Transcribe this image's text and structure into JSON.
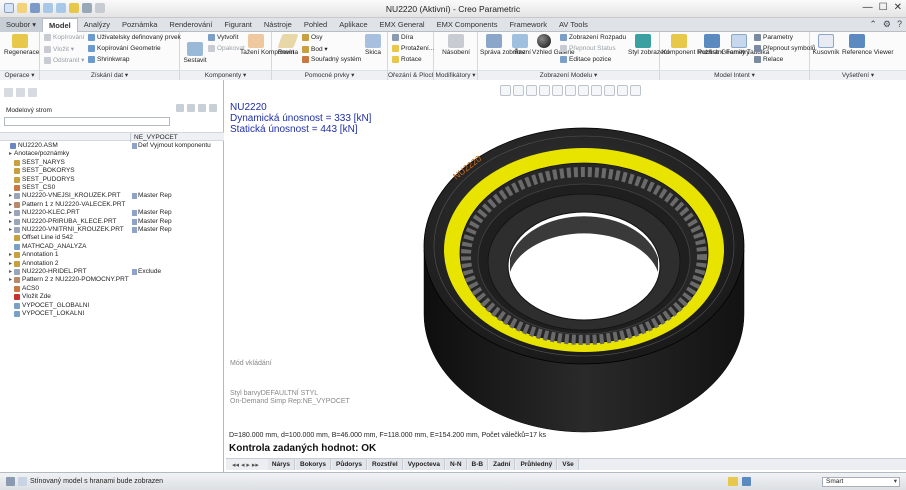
{
  "window": {
    "title": "NU2220 (Aktivní) - Creo Parametric"
  },
  "menu_tabs": [
    "Soubor ▾",
    "Model",
    "Analýzy",
    "Poznámka",
    "Renderování",
    "Figurant",
    "Nástroje",
    "Pohled",
    "Aplikace",
    "EMX General",
    "EMX Components",
    "Framework",
    "AV Tools"
  ],
  "ribbon": {
    "groups": {
      "operace": "Operace ▾",
      "ziskani_dat": "Získání dat ▾",
      "komponenty": "Komponenty ▾",
      "pomocne_prvky": "Pomocné prvky ▾",
      "orezani": "Ořezání & Plochy ▾",
      "modifikatory": "Modifikátory ▾",
      "zobrazeni_modelu": "Zobrazení Modelu ▾",
      "model_intent": "Model Intent ▾",
      "vysetreni": "Vyšetření ▾"
    },
    "regenerace": "Regenerace",
    "kopirovani": "Kopírování",
    "vlozit": "Vložit ▾",
    "odstranit": "Odstranit ▾",
    "uzivatelsky": "Uživatelsky definovaný prvek",
    "kopirovani_geometrie": "Kopírování Geometrie",
    "shrinkwrap": "Shrinkwrap",
    "sestavit": "Sestavit",
    "vytvorit": "Vytvořit",
    "opakovat": "Opakovat",
    "tazeni_komponent": "Tažení Komponent",
    "rovina": "Rovina",
    "osy": "Osy",
    "bod": "Bod ▾",
    "souradny_system": "Souřadný systém",
    "skica": "Skica",
    "dira": "Díra",
    "protazeni": "Protažení...",
    "rotace": "Rotace",
    "nasobeni": "Násobení",
    "sprava_zobrazeni": "Správa zobrazení",
    "rez": "Řez",
    "vzhled_galerie": "Vzhled Galerie",
    "zobrazeni_rozpadu": "Zobrazení Rozpadu",
    "prepnout_status": "Přepnout Status",
    "editace_pozice": "Editace pozice",
    "styl_zobrazeni": "Styl zobrazení",
    "komponent_rozhrani": "Komponent Rozhraní",
    "publish_geometry": "Publish Geometry",
    "family_tabulka": "Family Tabulka",
    "parametry": "Parametry",
    "prepnout_symbolu": "Přepnout symbolů",
    "relace": "Relace",
    "kusovnik": "Kusovník",
    "reference_viewer": "Reference Viewer"
  },
  "model_tree": {
    "title": "Modelový strom",
    "column2": "NE_VYPOCET",
    "rows": [
      {
        "name": "NU2220.ASM",
        "col2": "Def  Vyjmout komponentu",
        "color": "#6a87c4",
        "exp": ""
      },
      {
        "name": "Anotace/poznámky",
        "col2": "",
        "color": "",
        "exp": "▸"
      },
      {
        "name": "SEST_NARYS",
        "col2": "",
        "color": "#c8a040",
        "exp": ""
      },
      {
        "name": "SEST_BOKORYS",
        "col2": "",
        "color": "#c8a040",
        "exp": ""
      },
      {
        "name": "SEST_PUDORYS",
        "col2": "",
        "color": "#c8a040",
        "exp": ""
      },
      {
        "name": "SEST_CS0",
        "col2": "",
        "color": "#c87840",
        "exp": ""
      },
      {
        "name": "NU2220-VNEJSI_KROUZEK.PRT",
        "col2": "Master Rep",
        "color": "#9aa6b8",
        "exp": "▸"
      },
      {
        "name": "Pattern 1 z NU2220-VALECEK.PRT",
        "col2": "",
        "color": "#b88a6a",
        "exp": "▸"
      },
      {
        "name": "NU2220-KLEC.PRT",
        "col2": "Master Rep",
        "color": "#9aa6b8",
        "exp": "▸"
      },
      {
        "name": "NU2220-PRIRUBA_KLECE.PRT",
        "col2": "Master Rep",
        "color": "#9aa6b8",
        "exp": "▸"
      },
      {
        "name": "NU2220-VNITRNI_KROUZEK.PRT",
        "col2": "Master Rep",
        "color": "#9aa6b8",
        "exp": "▸"
      },
      {
        "name": "Offset Line id 542",
        "col2": "",
        "color": "#c8a040",
        "exp": ""
      },
      {
        "name": "MATHCAD_ANALYZA",
        "col2": "",
        "color": "#7aa0c8",
        "exp": ""
      },
      {
        "name": "Annotation 1",
        "col2": "",
        "color": "#c8a040",
        "exp": "▸"
      },
      {
        "name": "Annotation 2",
        "col2": "",
        "color": "#c8a040",
        "exp": "▸"
      },
      {
        "name": "NU2220-HRIDEL.PRT",
        "col2": "Exclude",
        "color": "#9aa6b8",
        "exp": "▸"
      },
      {
        "name": "Pattern 2 z NU2220-POMOCNY.PRT",
        "col2": "",
        "color": "#b88a6a",
        "exp": "▸"
      },
      {
        "name": "ACS0",
        "col2": "",
        "color": "#c87840",
        "exp": ""
      },
      {
        "name": "Vložit Zde",
        "col2": "",
        "color": "#c83030",
        "exp": ""
      },
      {
        "name": "VYPOCET_GLOBALNI",
        "col2": "",
        "color": "#7aa0c8",
        "exp": ""
      },
      {
        "name": "VYPOCET_LOKALNI",
        "col2": "",
        "color": "#7aa0c8",
        "exp": ""
      }
    ]
  },
  "graphics": {
    "title": "NU2220",
    "dyn": "Dynamická únosnost = 333 [kN]",
    "stat": "Statická únosnost = 443 [kN]",
    "label": "NU2220",
    "mod": "Mód vkládání",
    "style": "Styl barvyDEFAULTNÍ STYL",
    "rep": "On-Demand Simp Rep:NE_VYPOCET",
    "params": "D=180.000 mm, d=100.000 mm, B=46.000 mm, F=118.000 mm, E=154.200 mm, Počet válečků=17 ks",
    "check": "Kontrola zadaných hodnot: OK"
  },
  "view_tabs": [
    "Nárys",
    "Bokorys",
    "Půdorys",
    "Rozstřel",
    "Vypocteva",
    "N-N",
    "B-B",
    "Zadní",
    "Průhledný",
    "Vše"
  ],
  "status": {
    "message": "Stínovaný model s hranami bude zobrazen",
    "filter": "Smart"
  },
  "colors": {
    "accent": "#1f2fa8",
    "ring": "#e8e400"
  }
}
